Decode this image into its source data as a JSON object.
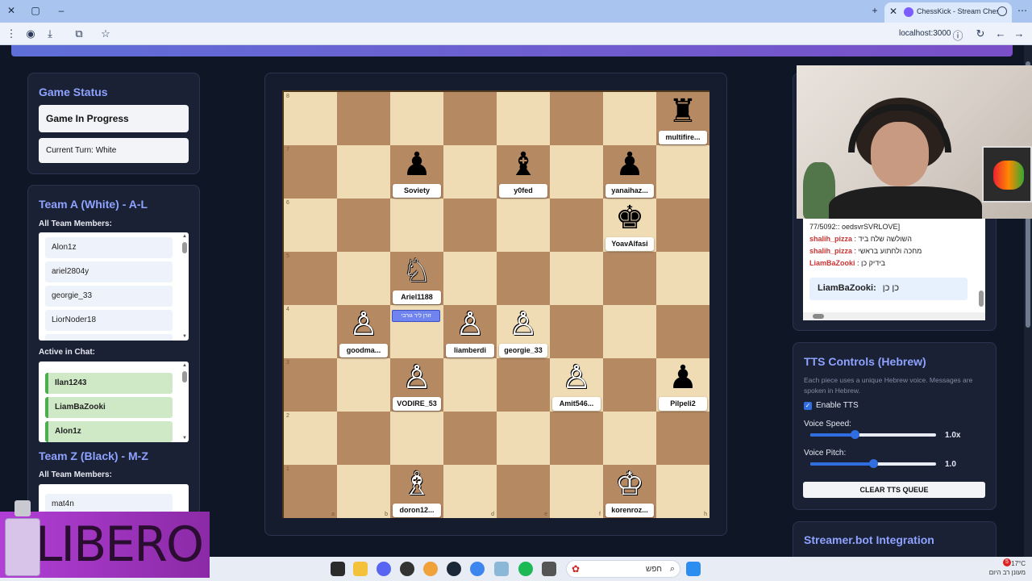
{
  "browser": {
    "tab_title": "ChessKick - Stream Chess G",
    "url": "localhost:3000"
  },
  "game_status": {
    "title": "Game Status",
    "state": "Game In Progress",
    "turn": "Current Turn: White"
  },
  "team_a": {
    "title": "Team A (White) - A-L",
    "members_label": "All Team Members:",
    "members": [
      "Alon1z",
      "ariel2804y",
      "georgie_33",
      "LiorNoder18"
    ],
    "active_label": "Active in Chat:",
    "active": [
      "Ilan1243",
      "LiamBaZooki",
      "Alon1z"
    ]
  },
  "team_z": {
    "title": "Team Z (Black) - M-Z",
    "members_label": "All Team Members:",
    "members": [
      "mat4n"
    ]
  },
  "board": {
    "files": [
      "a",
      "b",
      "c",
      "d",
      "e",
      "f",
      "g",
      "h"
    ],
    "ranks": [
      "8",
      "7",
      "6",
      "5",
      "4",
      "3",
      "2",
      "1"
    ],
    "pieces": [
      {
        "square": "h8",
        "glyph": "♜",
        "color": "black",
        "label": "multifire..."
      },
      {
        "square": "c7",
        "glyph": "♟",
        "color": "black",
        "label": "Soviety"
      },
      {
        "square": "e7",
        "glyph": "♝",
        "color": "black",
        "label": "y0fed"
      },
      {
        "square": "g7",
        "glyph": "♟",
        "color": "black",
        "label": "yanaihaz..."
      },
      {
        "square": "g6",
        "glyph": "♚",
        "color": "black",
        "label": "YoavAlfasi"
      },
      {
        "square": "c5",
        "glyph": "♘",
        "color": "white",
        "label": "Ariel1188"
      },
      {
        "square": "b4",
        "glyph": "♙",
        "color": "white",
        "label": "goodma..."
      },
      {
        "square": "d4",
        "glyph": "♙",
        "color": "white",
        "label": "liamberdi"
      },
      {
        "square": "e4",
        "glyph": "♙",
        "color": "white",
        "label": "georgie_33"
      },
      {
        "square": "c3",
        "glyph": "♙",
        "color": "white",
        "label": "VODIRE_53"
      },
      {
        "square": "f3",
        "glyph": "♙",
        "color": "white",
        "label": "Amit546..."
      },
      {
        "square": "h3",
        "glyph": "♟",
        "color": "black",
        "label": "Pilpeli2"
      },
      {
        "square": "c1",
        "glyph": "♗",
        "color": "white",
        "label": "doron12..."
      },
      {
        "square": "g1",
        "glyph": "♔",
        "color": "white",
        "label": "korenroz..."
      }
    ],
    "bubble": "זורן ליר גורבי"
  },
  "chat": {
    "lines": [
      {
        "user": "",
        "text": "77/5092:: oedsvrSVRLOVE]"
      },
      {
        "user": "shalih_pizza",
        "text": ": השולשה שלח ביד"
      },
      {
        "user": "shalih_pizza",
        "text": ": מחכה ולחתוע בראשי"
      },
      {
        "user": "LiamBaZooki",
        "text": ": בידיק כן"
      }
    ],
    "last_user": "LiamBaZooki:",
    "last_text": "כן כן"
  },
  "tts": {
    "title": "TTS Controls (Hebrew)",
    "description": "Each piece uses a unique Hebrew voice. Messages are spoken in Hebrew.",
    "enable_label": "Enable TTS",
    "speed_label": "Voice Speed:",
    "speed_value": "1.0x",
    "speed_fraction": 0.35,
    "pitch_label": "Voice Pitch:",
    "pitch_value": "1.0",
    "pitch_fraction": 0.5,
    "clear_label": "CLEAR TTS QUEUE"
  },
  "streamerbot": {
    "title": "Streamer.bot Integration"
  },
  "overlay": {
    "brand": "LIBERO"
  },
  "taskbar": {
    "search_text": "חפש",
    "temperature": "17°C",
    "weather_text": "מעונן רב היום",
    "notifications": "5"
  }
}
